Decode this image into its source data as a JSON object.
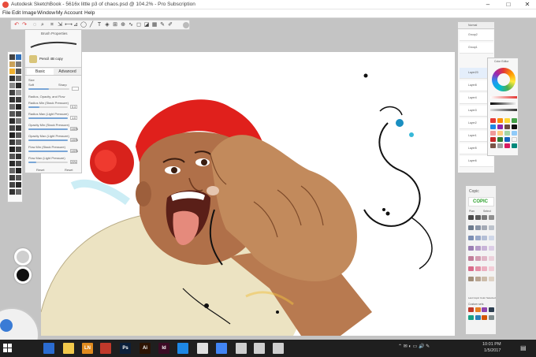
{
  "window": {
    "title": "Autodesk SketchBook - 5616x little p3 of chaos.psd @ 104.2% - Pro Subscription"
  },
  "menu": {
    "items": [
      "File",
      "Edit",
      "Image",
      "Window",
      "My Account",
      "Help"
    ]
  },
  "brush_properties": {
    "header": "Brush Properties",
    "brush_name": "Pencil 4B copy",
    "tab_basic": "Basic",
    "tab_advanced": "Advanced",
    "size_label": "Size",
    "size_min": "Soft",
    "size_max": "Sharp",
    "section_radius": "Radius, Opacity, and Flow",
    "rows": [
      {
        "label": "Radius Min (Stack Pressure)",
        "value": "0.3"
      },
      {
        "label": "Radius Max (Light Pressure)",
        "value": "1.0"
      },
      {
        "label": "Opacity Min (Stack Pressure)",
        "value": "100%"
      },
      {
        "label": "Opacity Max (Light Pressure)",
        "value": "100%"
      },
      {
        "label": "Flow Min (Stack Pressure)",
        "value": "100%"
      },
      {
        "label": "Flow Max (Light Pressure)",
        "value": "20%"
      }
    ],
    "reset_label": "Reset",
    "reset2_label": "Reset"
  },
  "layers": {
    "blend_mode": "Normal",
    "rows": [
      "Group2",
      "Group1",
      "Layer20",
      "Layer8",
      "Layer4",
      "Layer3",
      "Layer2",
      "Layer1",
      "Layer5",
      "Layer6"
    ]
  },
  "color_editor": {
    "header": "Color Editor"
  },
  "copic": {
    "header": "Copic",
    "logo": "COPIC",
    "tab_all": "Plan",
    "tab_select": "Select",
    "footer": "Last Copic Color Selected",
    "custom_label": "Custom sets",
    "colors": [
      "#4a4a4a",
      "#5c5c5c",
      "#7a7a7a",
      "#8f8f8f",
      "#6d7b8d",
      "#8894a6",
      "#a4aab5",
      "#bcc2cb",
      "#7d8fb3",
      "#98a8c9",
      "#b4bfd6",
      "#cfd7e8",
      "#9b7fb3",
      "#b59bc9",
      "#c9b4d8",
      "#dccde6",
      "#c07e99",
      "#d29bb0",
      "#e0b6c6",
      "#ecd1db",
      "#d86b8a",
      "#e48fa6",
      "#ecb0c0",
      "#f3cdd7",
      "#a38f7a",
      "#b8a591",
      "#ccbca9",
      "#dfd3c5"
    ],
    "custom_colors": [
      "#c0392b",
      "#e67e22",
      "#8e44ad",
      "#2c3e50",
      "#16a085",
      "#2980b9",
      "#d35400",
      "#7f8c8d"
    ]
  },
  "taskbar": {
    "time": "10:01 PM",
    "date": "1/5/2017",
    "apps": [
      {
        "label": "",
        "color": "#2b6cd1"
      },
      {
        "label": "",
        "color": "#f2c94c"
      },
      {
        "label": "LN",
        "color": "#e08b1f"
      },
      {
        "label": "",
        "color": "#c0392b"
      },
      {
        "label": "Ps",
        "color": "#0b1f3a"
      },
      {
        "label": "Ai",
        "color": "#2d1404"
      },
      {
        "label": "Id",
        "color": "#3c0b25"
      },
      {
        "label": "",
        "color": "#1e88e5"
      },
      {
        "label": "",
        "color": "#e0e0e0"
      },
      {
        "label": "",
        "color": "#4285f4"
      },
      {
        "label": "",
        "color": "#cfcfcf"
      },
      {
        "label": "",
        "color": "#cfcfcf"
      },
      {
        "label": "",
        "color": "#cfcfcf"
      }
    ]
  },
  "colors": {
    "accent": "#2b6cd1",
    "hair": "#e0201c"
  }
}
